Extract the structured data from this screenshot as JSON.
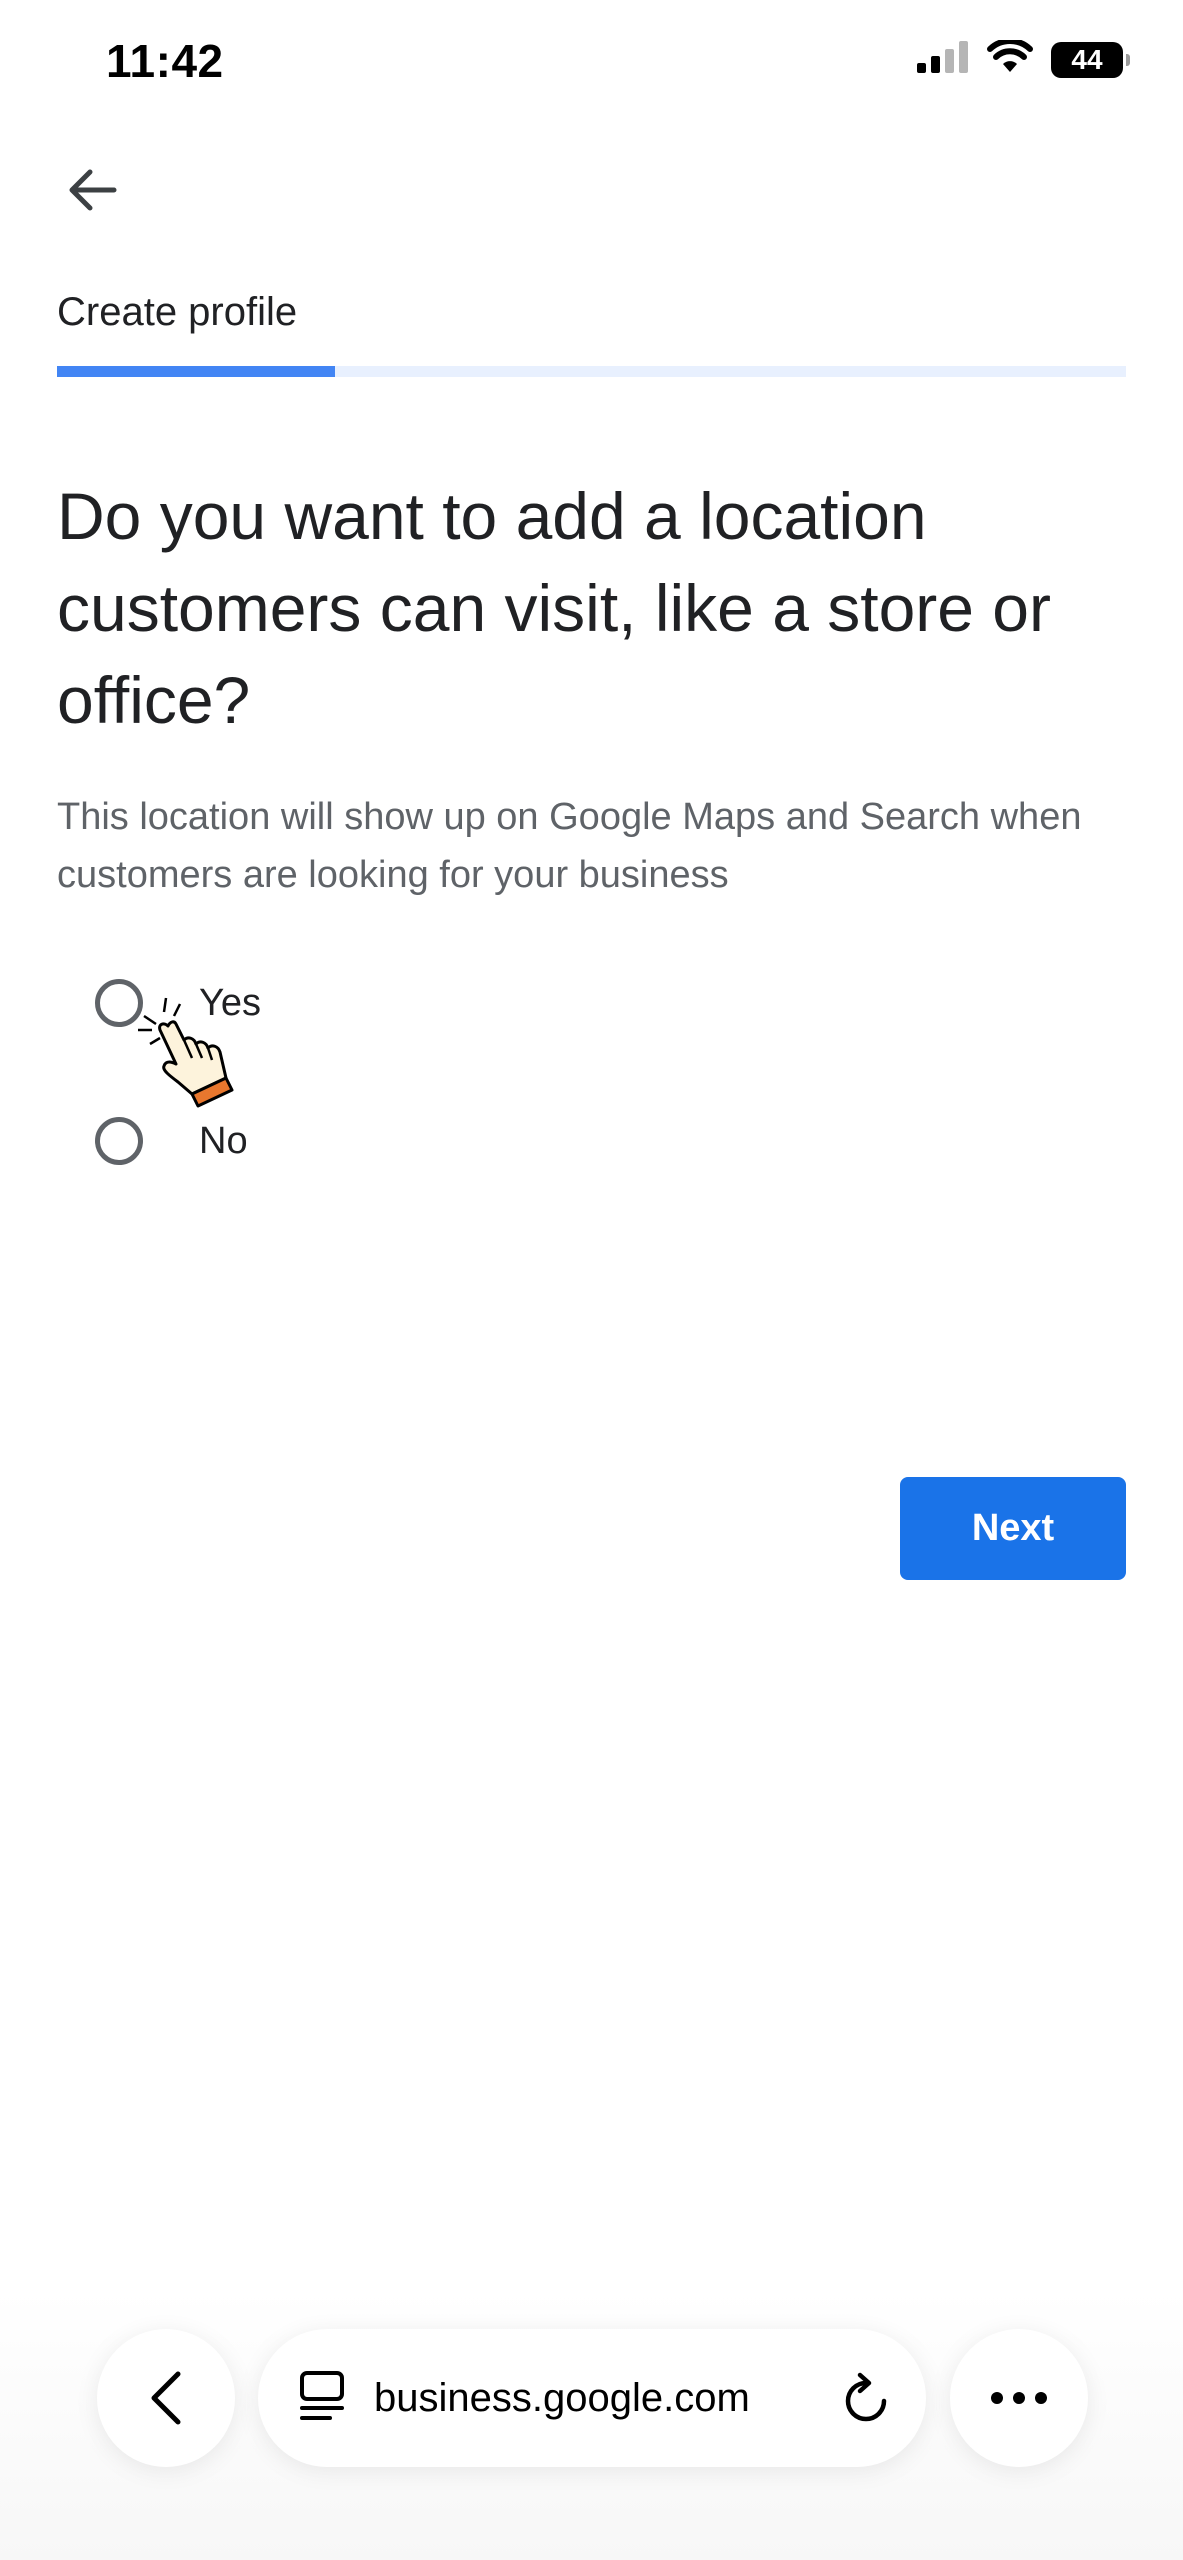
{
  "status_bar": {
    "time": "11:42",
    "battery": "44"
  },
  "header": {
    "title": "Create profile",
    "progress": 0.26
  },
  "main": {
    "question": "Do you want to add a location customers can visit, like a store or office?",
    "subtitle": "This location will show up on Google Maps and Search when customers are looking for your business",
    "options": [
      {
        "label": "Yes",
        "selected": false
      },
      {
        "label": "No",
        "selected": false
      }
    ],
    "next_label": "Next"
  },
  "browser": {
    "url": "business.google.com"
  },
  "colors": {
    "primary": "#1a73e8",
    "progress": "#4285f4",
    "progress_track": "#e8f0fe"
  }
}
